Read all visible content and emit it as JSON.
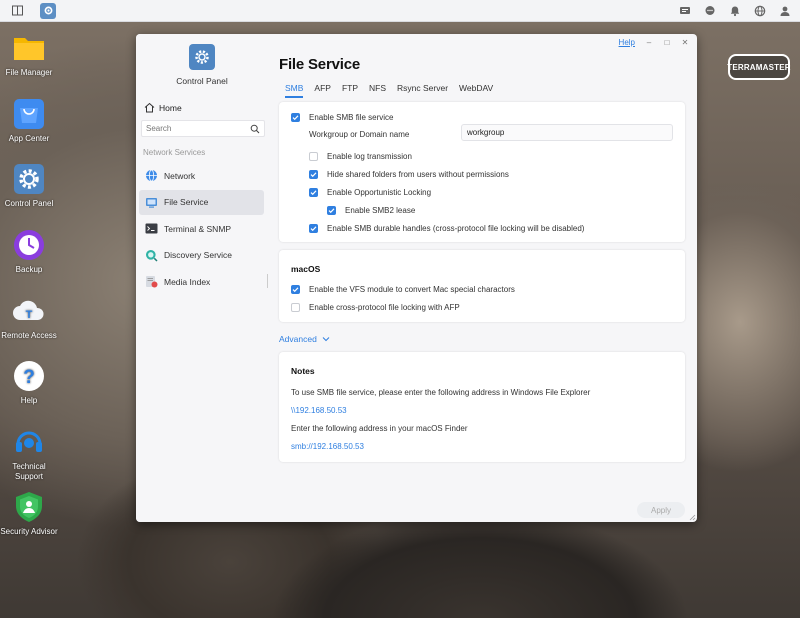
{
  "topbar": {
    "left_icons": [
      "desktop-icon",
      "control-panel-icon"
    ],
    "right_icons": [
      "task-icon",
      "message-icon",
      "notification-icon",
      "globe-icon",
      "user-icon"
    ]
  },
  "desktop": {
    "icons": [
      {
        "label": "File Manager",
        "icon": "folder-icon"
      },
      {
        "label": "App Center",
        "icon": "shopping-bag-icon"
      },
      {
        "label": "Control Panel",
        "icon": "gear-icon"
      },
      {
        "label": "Backup",
        "icon": "clock-icon"
      },
      {
        "label": "Remote Access",
        "icon": "cloud-icon"
      },
      {
        "label": "Help",
        "icon": "question-icon"
      },
      {
        "label": "Technical Support",
        "icon": "headset-icon"
      },
      {
        "label": "Security Advisor",
        "icon": "shield-icon"
      }
    ],
    "brand_logo": "TERRAMASTER"
  },
  "window": {
    "help_label": "Help",
    "sidebar": {
      "app_title": "Control Panel",
      "home_label": "Home",
      "search_placeholder": "Search",
      "section_label": "Network Services",
      "items": [
        {
          "label": "Network",
          "icon": "network-globe-icon"
        },
        {
          "label": "File Service",
          "icon": "file-service-icon"
        },
        {
          "label": "Terminal & SNMP",
          "icon": "terminal-icon"
        },
        {
          "label": "Discovery Service",
          "icon": "discovery-icon"
        },
        {
          "label": "Media Index",
          "icon": "media-index-icon"
        }
      ],
      "active_index": 1
    },
    "main": {
      "title": "File Service",
      "tabs": [
        "SMB",
        "AFP",
        "FTP",
        "NFS",
        "Rsync Server",
        "WebDAV"
      ],
      "active_tab": 0,
      "smb": {
        "enable_smb": {
          "label": "Enable SMB file service",
          "checked": true
        },
        "workgroup_label": "Workgroup or Domain name",
        "workgroup_value": "workgroup",
        "log_transmission": {
          "label": "Enable log transmission",
          "checked": false
        },
        "hide_shared": {
          "label": "Hide shared folders from users without permissions",
          "checked": true
        },
        "opportunistic_locking": {
          "label": "Enable Opportunistic Locking",
          "checked": true
        },
        "smb2_lease": {
          "label": "Enable SMB2 lease",
          "checked": true
        },
        "durable_handles": {
          "label": "Enable SMB durable handles (cross-protocol file locking will be disabled)",
          "checked": true
        }
      },
      "macos": {
        "heading": "macOS",
        "vfs_module": {
          "label": "Enable the VFS module to convert Mac special charactors",
          "checked": true
        },
        "afp_locking": {
          "label": "Enable cross-protocol file locking with AFP",
          "checked": false
        }
      },
      "advanced_label": "Advanced",
      "notes": {
        "heading": "Notes",
        "line1": "To use SMB file service, please enter the following address in Windows File Explorer",
        "windows_address": "\\\\192.168.50.53",
        "line2": "Enter the following address in your macOS Finder",
        "mac_address": "smb://192.168.50.53"
      },
      "apply_label": "Apply"
    }
  },
  "colors": {
    "accent": "#2f7fe0",
    "checkbox_on": "#2f7fe0",
    "sidebar_active": "#e2e3e8"
  }
}
